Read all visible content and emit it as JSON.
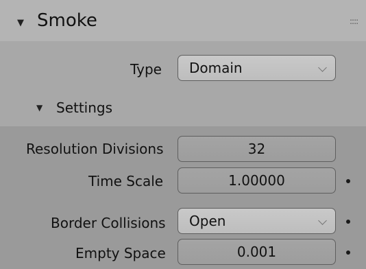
{
  "panel": {
    "title": "Smoke",
    "collapse_glyph": "▼",
    "grip_glyph": "::::"
  },
  "type_row": {
    "label": "Type",
    "value": "Domain"
  },
  "settings": {
    "title": "Settings",
    "collapse_glyph": "▼",
    "resolution": {
      "label": "Resolution Divisions",
      "value": "32"
    },
    "time_scale": {
      "label": "Time Scale",
      "value": "1.00000"
    },
    "border_collisions": {
      "label": "Border Collisions",
      "value": "Open"
    },
    "empty_space": {
      "label": "Empty Space",
      "value": "0.001"
    }
  }
}
